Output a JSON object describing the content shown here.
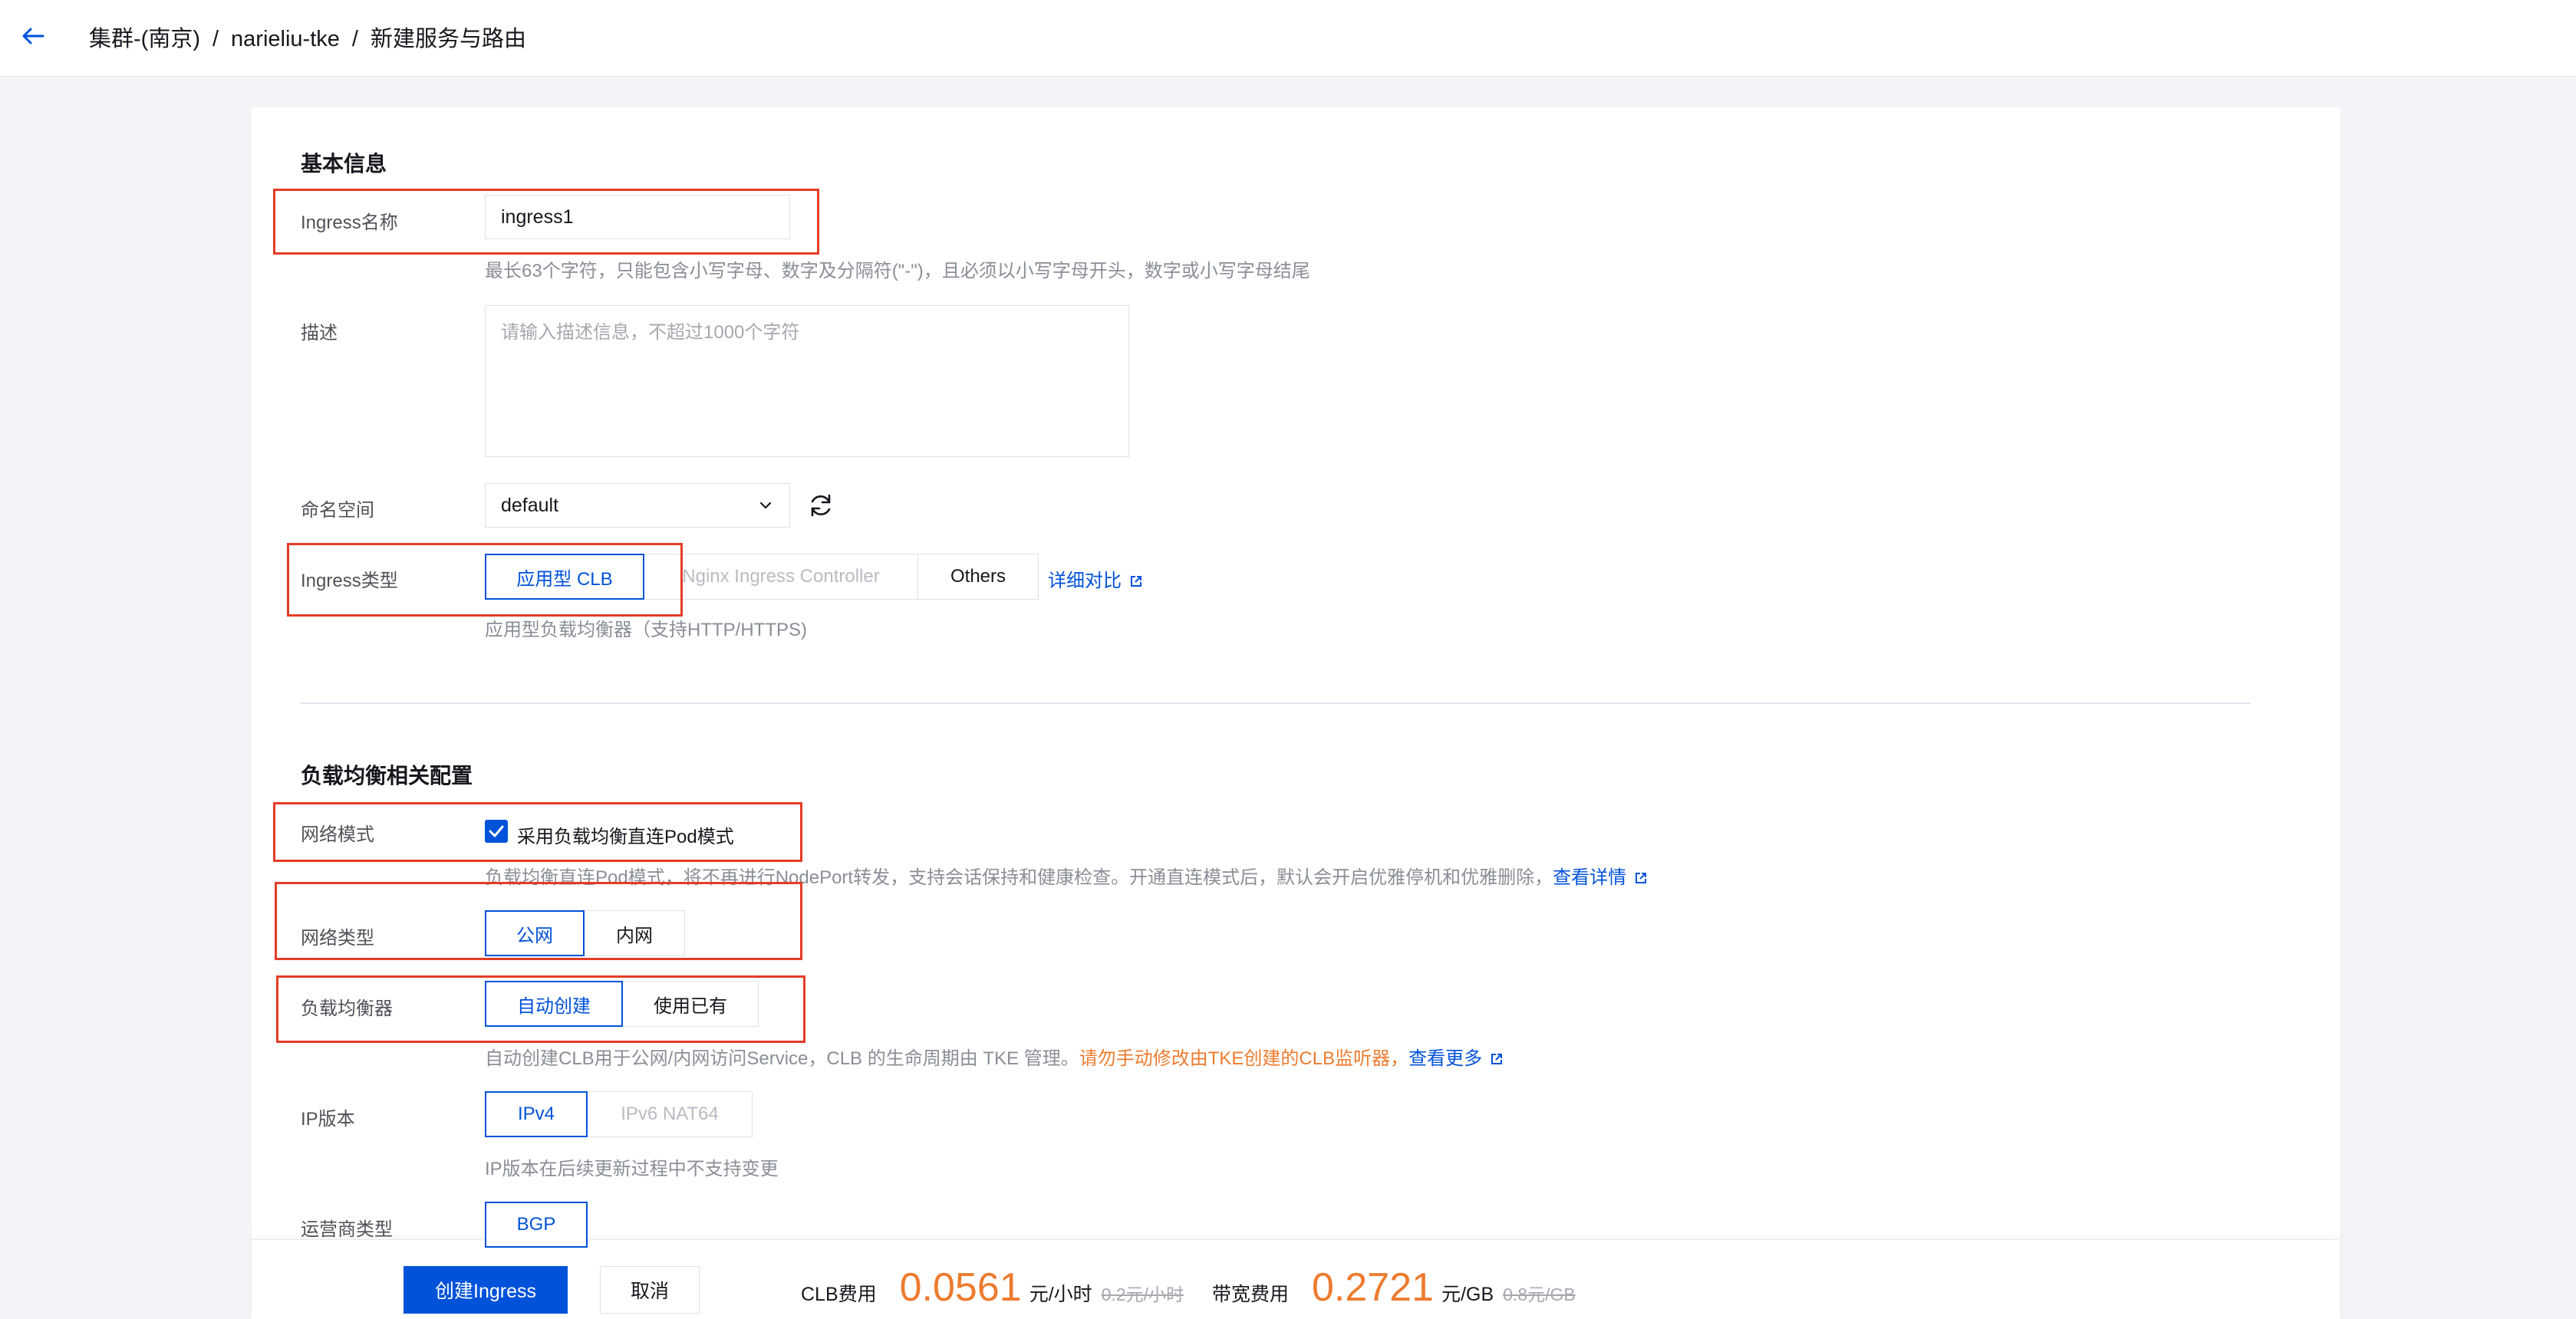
{
  "header": {
    "breadcrumb": [
      "集群-(南京)",
      "narieliu-tke",
      "新建服务与路由"
    ],
    "separator": "/"
  },
  "basic_info": {
    "section_title": "基本信息",
    "ingress_name": {
      "label": "Ingress名称",
      "value": "ingress1",
      "hint": "最长63个字符，只能包含小写字母、数字及分隔符(\"-\")，且必须以小写字母开头，数字或小写字母结尾"
    },
    "description": {
      "label": "描述",
      "placeholder": "请输入描述信息，不超过1000个字符"
    },
    "namespace": {
      "label": "命名空间",
      "value": "default"
    },
    "ingress_type": {
      "label": "Ingress类型",
      "options": [
        "应用型 CLB",
        "Nginx Ingress Controller",
        "Others"
      ],
      "selected": "应用型 CLB",
      "compare_link": "详细对比",
      "hint": "应用型负载均衡器（支持HTTP/HTTPS)"
    }
  },
  "lb_config": {
    "section_title": "负载均衡相关配置",
    "network_mode": {
      "label": "网络模式",
      "checkbox_label": "采用负载均衡直连Pod模式",
      "checked": true,
      "hint": "负载均衡直连Pod模式，将不再进行NodePort转发，支持会话保持和健康检查。开通直连模式后，默认会开启优雅停机和优雅删除，",
      "hint_link": "查看详情"
    },
    "network_type": {
      "label": "网络类型",
      "options": [
        "公网",
        "内网"
      ],
      "selected": "公网"
    },
    "load_balancer": {
      "label": "负载均衡器",
      "options": [
        "自动创建",
        "使用已有"
      ],
      "selected": "自动创建",
      "hint": "自动创建CLB用于公网/内网访问Service，CLB 的生命周期由 TKE 管理。",
      "warning": "请勿手动修改由TKE创建的CLB监听器，",
      "more_link": "查看更多"
    },
    "ip_version": {
      "label": "IP版本",
      "options": [
        "IPv4",
        "IPv6 NAT64"
      ],
      "selected": "IPv4",
      "hint": "IP版本在后续更新过程中不支持变更"
    },
    "isp_type": {
      "label": "运营商类型",
      "options": [
        "BGP"
      ],
      "selected": "BGP"
    }
  },
  "footer": {
    "create_button": "创建Ingress",
    "cancel_button": "取消",
    "clb_fee_label": "CLB费用",
    "clb_fee": "0.0561",
    "clb_fee_unit": "元/小时",
    "clb_fee_original": "0.2元/小时",
    "bandwidth_fee_label": "带宽费用",
    "bandwidth_fee": "0.2721",
    "bandwidth_fee_unit": "元/GB",
    "bandwidth_fee_original": "0.8元/GB"
  },
  "colors": {
    "primary": "#0052d9",
    "accent_orange": "#ed7b2f",
    "highlight_red": "#e43c26"
  }
}
